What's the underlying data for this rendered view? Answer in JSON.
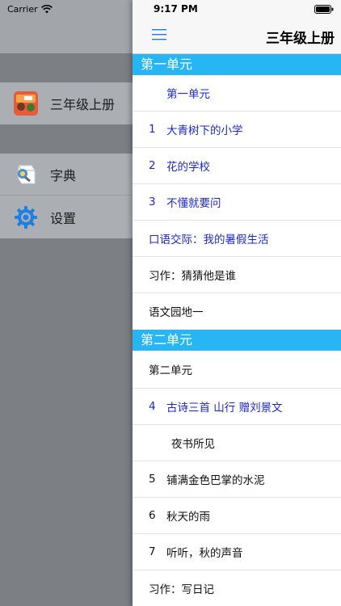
{
  "status": {
    "carrier": "Carrier",
    "time": "9:17 PM"
  },
  "drawer": {
    "items": [
      {
        "label": "三年级上册"
      },
      {
        "label": "字典"
      },
      {
        "label": "设置"
      }
    ]
  },
  "nav": {
    "title": "三年级上册"
  },
  "sections": [
    {
      "header": "第一单元",
      "rows": [
        {
          "num": "",
          "text": "第一单元",
          "color": "blue"
        },
        {
          "num": "1",
          "text": "大青树下的小学",
          "color": "blue"
        },
        {
          "num": "2",
          "text": "花的学校",
          "color": "blue"
        },
        {
          "num": "3",
          "text": "不懂就要问",
          "color": "blue"
        },
        {
          "num": "",
          "text": "口语交际：我的暑假生活",
          "color": "blue"
        },
        {
          "num": "",
          "text": "习作：猜猜他是谁",
          "color": "black"
        },
        {
          "num": "",
          "text": "语文园地一",
          "color": "black"
        }
      ]
    },
    {
      "header": "第二单元",
      "rows": [
        {
          "num": "",
          "text": "第二单元",
          "color": "black"
        },
        {
          "num": "4",
          "text": "古诗三首  山行  赠刘景文",
          "color": "blue"
        },
        {
          "num": "",
          "text": "夜书所见",
          "color": "black"
        },
        {
          "num": "5",
          "text": "铺满金色巴掌的水泥",
          "color": "black"
        },
        {
          "num": "6",
          "text": "秋天的雨",
          "color": "black"
        },
        {
          "num": "7",
          "text": "听听，秋的声音",
          "color": "black"
        },
        {
          "num": "",
          "text": "习作：写日记",
          "color": "black"
        }
      ]
    }
  ],
  "colors": {
    "section_header": "#28b5f4",
    "link_blue": "#1c27d0"
  }
}
